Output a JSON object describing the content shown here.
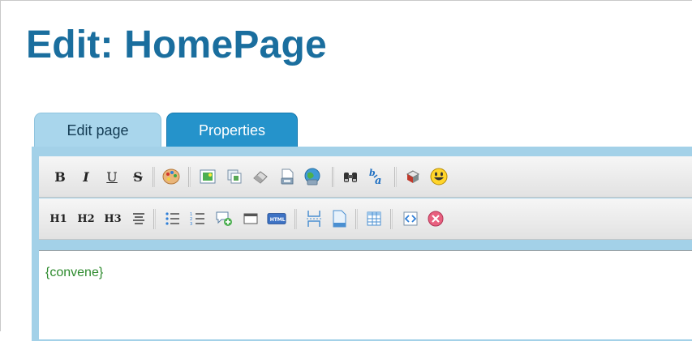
{
  "page": {
    "title": "Edit: HomePage"
  },
  "tabs": [
    {
      "label": "Edit page",
      "active": true
    },
    {
      "label": "Properties",
      "active": false
    }
  ],
  "toolbar": {
    "row1": [
      "bold",
      "italic",
      "underline",
      "strikethrough",
      "text-color",
      "image",
      "copy",
      "eraser",
      "save",
      "globe",
      "find",
      "replace",
      "cube",
      "smiley"
    ],
    "row2": [
      "h1",
      "h2",
      "h3",
      "align",
      "bulleted-list",
      "numbered-list",
      "comment",
      "window",
      "html",
      "page-break",
      "page",
      "table",
      "source",
      "cancel"
    ],
    "labels": {
      "bold": "B",
      "italic": "I",
      "underline": "U",
      "strikethrough": "S",
      "h1": "H1",
      "h2": "H2",
      "h3": "H3"
    }
  },
  "editor": {
    "content": "{convene}"
  },
  "colors": {
    "title": "#1a6e9e",
    "tab_active_bg": "#a9d6ec",
    "tab_inactive_bg": "#2593cb",
    "editor_border": "#a3d1e8",
    "content_text": "#2e8b2e"
  }
}
